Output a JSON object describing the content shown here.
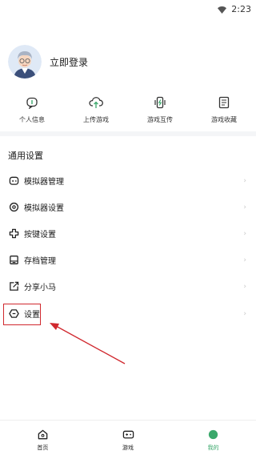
{
  "status_bar": {
    "time": "2:23",
    "icons": [
      "wifi-icon"
    ]
  },
  "profile": {
    "login_text": "立即登录",
    "avatar": "avatar-icon"
  },
  "quick_actions": [
    {
      "label": "个人信息",
      "icon": "chat-badge-icon"
    },
    {
      "label": "上传游戏",
      "icon": "cloud-upload-icon"
    },
    {
      "label": "游戏互传",
      "icon": "phone-transfer-icon"
    },
    {
      "label": "游戏收藏",
      "icon": "list-icon"
    }
  ],
  "section": {
    "title": "通用设置"
  },
  "menu": [
    {
      "label": "模拟器管理",
      "icon": "gamepad-icon"
    },
    {
      "label": "模拟器设置",
      "icon": "gear-icon"
    },
    {
      "label": "按键设置",
      "icon": "dpad-icon"
    },
    {
      "label": "存档管理",
      "icon": "save-icon"
    },
    {
      "label": "分享小马",
      "icon": "share-icon"
    },
    {
      "label": "设置",
      "icon": "settings-icon"
    }
  ],
  "chevron": "›",
  "tabs": [
    {
      "label": "首页",
      "icon": "home-icon",
      "active": false
    },
    {
      "label": "游戏",
      "icon": "game-icon",
      "active": false
    },
    {
      "label": "我的",
      "icon": "profile-dot-icon",
      "active": true
    }
  ],
  "colors": {
    "accent": "#3aa86b",
    "annotation": "#d0282e"
  }
}
